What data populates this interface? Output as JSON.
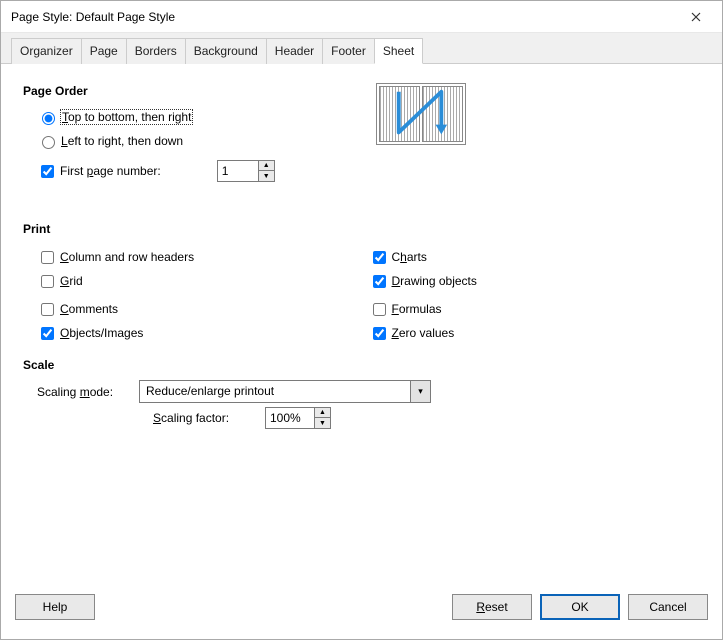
{
  "title": "Page Style: Default Page Style",
  "tabs": [
    "Organizer",
    "Page",
    "Borders",
    "Background",
    "Header",
    "Footer",
    "Sheet"
  ],
  "active_tab": "Sheet",
  "page_order": {
    "title": "Page Order",
    "opt1": "Top to bottom, then right",
    "opt2": "Left to right, then down",
    "selected": "opt1",
    "first_page_label": "First page number:",
    "first_page_checked": true,
    "first_page_value": "1"
  },
  "print": {
    "title": "Print",
    "left": [
      {
        "label": "Column and row headers",
        "checked": false,
        "u": "C"
      },
      {
        "label": "Grid",
        "checked": false,
        "u": "G"
      },
      {
        "label": "Comments",
        "checked": false,
        "u": "C"
      },
      {
        "label": "Objects/Images",
        "checked": true,
        "u": "O"
      }
    ],
    "right": [
      {
        "label": "Charts",
        "checked": true,
        "u": "h"
      },
      {
        "label": "Drawing objects",
        "checked": true,
        "u": "D"
      },
      {
        "label": "Formulas",
        "checked": false,
        "u": "F"
      },
      {
        "label": "Zero values",
        "checked": true,
        "u": "Z"
      }
    ]
  },
  "scale": {
    "title": "Scale",
    "mode_label": "Scaling mode:",
    "mode_value": "Reduce/enlarge printout",
    "factor_label": "Scaling factor:",
    "factor_value": "100%"
  },
  "buttons": {
    "help": "Help",
    "reset": "Reset",
    "ok": "OK",
    "cancel": "Cancel"
  }
}
